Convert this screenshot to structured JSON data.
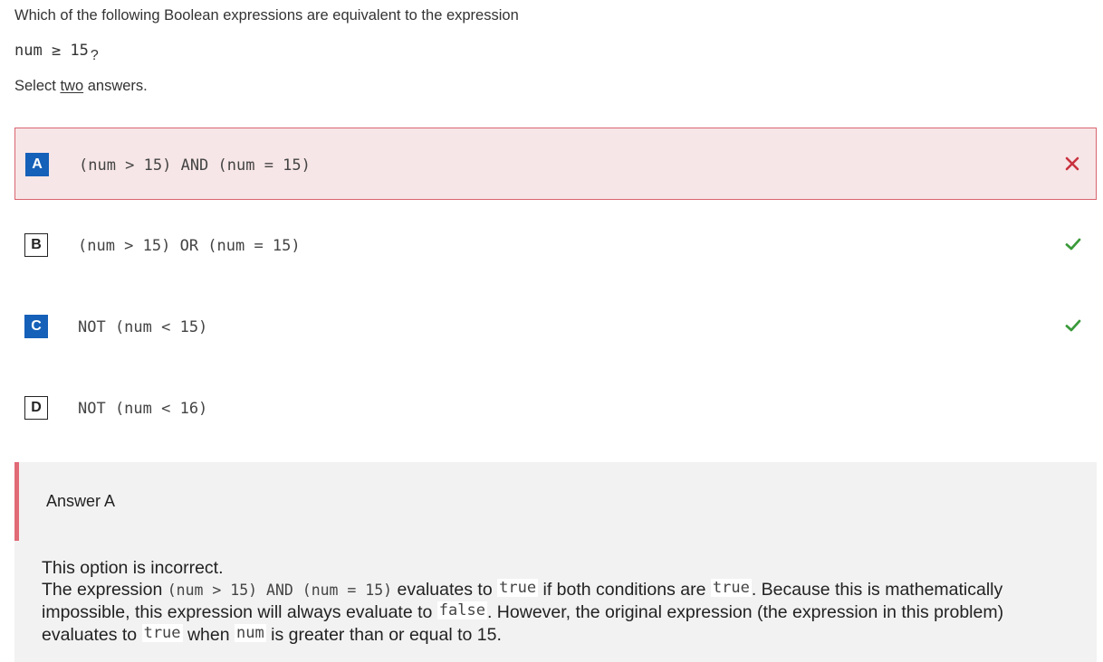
{
  "question": {
    "prompt": "Which of the following Boolean expressions are equivalent to the expression",
    "expression": "num ≥ 15",
    "expression_suffix": "?",
    "instruction_prefix": "Select ",
    "instruction_emph": "two",
    "instruction_suffix": " answers."
  },
  "options": [
    {
      "letter": "A",
      "code": "(num > 15) AND (num = 15)",
      "state": "incorrect-selected",
      "mark_icon": "cross-icon"
    },
    {
      "letter": "B",
      "code": "(num > 15) OR (num = 15)",
      "state": "correct",
      "mark_icon": "check-icon"
    },
    {
      "letter": "C",
      "code": "NOT (num < 15)",
      "state": "correct-selected",
      "mark_icon": "check-icon"
    },
    {
      "letter": "D",
      "code": "NOT (num < 16)",
      "state": "unselected",
      "mark_icon": ""
    }
  ],
  "feedback": {
    "title": "Answer A",
    "line1": "This option is incorrect.",
    "p_intro": "The expression ",
    "p_code": "(num > 15) AND (num = 15)",
    "p_eval": " evaluates to ",
    "p_true1": "true",
    "p_if": " if both conditions are ",
    "p_true2": "true",
    "p_because": ". Because this is mathematically impossible, this expression will always evaluate to ",
    "p_false": "false",
    "p_however": ". However, the original expression (the expression in this problem) evaluates to ",
    "p_true3": "true",
    "p_when": " when ",
    "p_num": "num",
    "p_end": " is greater than or equal to 15."
  },
  "colors": {
    "selected_letter": "#1560b8",
    "incorrect_bg": "#f7e6e7",
    "incorrect_border": "#d9646f",
    "cross": "#c8323f",
    "check": "#3a9a3a",
    "feedback_bar": "#e06a76"
  }
}
